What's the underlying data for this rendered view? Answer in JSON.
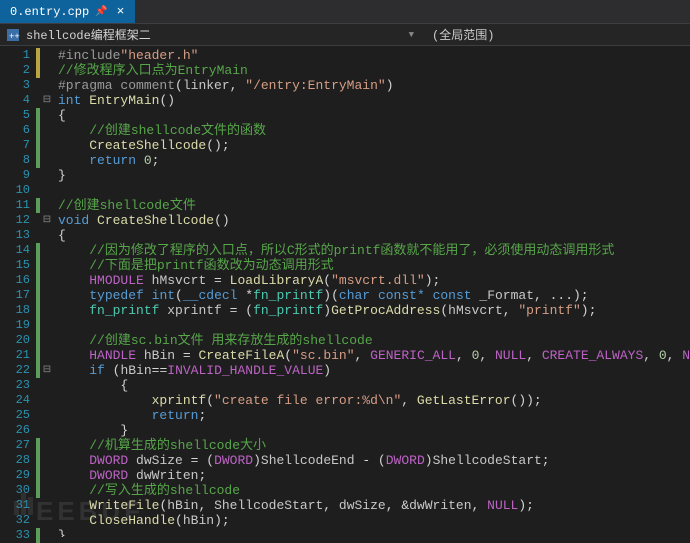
{
  "tab": {
    "filename": "0.entry.cpp",
    "pin": "📌",
    "close": "×"
  },
  "nav": {
    "unit": "shellcode编程框架二",
    "scope": "(全局范围)"
  },
  "watermark": "EEBUF",
  "lines": [
    {
      "n": 1,
      "fold": "",
      "chg": "y",
      "tokens": [
        [
          "pp",
          "#include"
        ],
        [
          "str",
          "\"header.h\""
        ]
      ]
    },
    {
      "n": 2,
      "fold": "",
      "chg": "y",
      "tokens": [
        [
          "cmt",
          "//修改程序入口点为EntryMain"
        ]
      ]
    },
    {
      "n": 3,
      "fold": "",
      "chg": "",
      "tokens": [
        [
          "pp",
          "#pragma comment"
        ],
        [
          "pun",
          "("
        ],
        [
          "id",
          "linker"
        ],
        [
          "pun",
          ", "
        ],
        [
          "str",
          "\"/entry:EntryMain\""
        ],
        [
          "pun",
          ")"
        ]
      ]
    },
    {
      "n": 4,
      "fold": "⊟",
      "chg": "",
      "tokens": [
        [
          "kw",
          "int"
        ],
        [
          "pun",
          " "
        ],
        [
          "fn",
          "EntryMain"
        ],
        [
          "pun",
          "()"
        ]
      ]
    },
    {
      "n": 5,
      "fold": "",
      "chg": "g",
      "tokens": [
        [
          "pun",
          "{"
        ]
      ]
    },
    {
      "n": 6,
      "fold": "",
      "chg": "g",
      "tokens": [
        [
          "pun",
          "    "
        ],
        [
          "cmt",
          "//创建shellcode文件的函数"
        ]
      ]
    },
    {
      "n": 7,
      "fold": "",
      "chg": "g",
      "tokens": [
        [
          "pun",
          "    "
        ],
        [
          "fn",
          "CreateShellcode"
        ],
        [
          "pun",
          "();"
        ]
      ]
    },
    {
      "n": 8,
      "fold": "",
      "chg": "g",
      "tokens": [
        [
          "pun",
          "    "
        ],
        [
          "kw",
          "return"
        ],
        [
          "pun",
          " "
        ],
        [
          "num",
          "0"
        ],
        [
          "pun",
          ";"
        ]
      ]
    },
    {
      "n": 9,
      "fold": "",
      "chg": "",
      "tokens": [
        [
          "pun",
          "}"
        ]
      ]
    },
    {
      "n": 10,
      "fold": "",
      "chg": "",
      "tokens": []
    },
    {
      "n": 11,
      "fold": "",
      "chg": "g",
      "tokens": [
        [
          "cmt",
          "//创建shellcode文件"
        ]
      ]
    },
    {
      "n": 12,
      "fold": "⊟",
      "chg": "",
      "tokens": [
        [
          "kw",
          "void"
        ],
        [
          "pun",
          " "
        ],
        [
          "fn",
          "CreateShellcode"
        ],
        [
          "pun",
          "()"
        ]
      ]
    },
    {
      "n": 13,
      "fold": "",
      "chg": "",
      "tokens": [
        [
          "pun",
          "{"
        ]
      ]
    },
    {
      "n": 14,
      "fold": "",
      "chg": "g",
      "tokens": [
        [
          "pun",
          "    "
        ],
        [
          "cmt",
          "//因为修改了程序的入口点，所以C形式的printf函数就不能用了，必须使用动态调用形式"
        ]
      ]
    },
    {
      "n": 15,
      "fold": "",
      "chg": "g",
      "tokens": [
        [
          "pun",
          "    "
        ],
        [
          "cmt",
          "//下面是把printf函数改为动态调用形式"
        ]
      ]
    },
    {
      "n": 16,
      "fold": "",
      "chg": "g",
      "tokens": [
        [
          "pun",
          "    "
        ],
        [
          "mac",
          "HMODULE"
        ],
        [
          "pun",
          " "
        ],
        [
          "id",
          "hMsvcrt"
        ],
        [
          "pun",
          " = "
        ],
        [
          "fn",
          "LoadLibraryA"
        ],
        [
          "pun",
          "("
        ],
        [
          "str",
          "\"msvcrt.dll\""
        ],
        [
          "pun",
          ");"
        ]
      ]
    },
    {
      "n": 17,
      "fold": "",
      "chg": "g",
      "tokens": [
        [
          "pun",
          "    "
        ],
        [
          "kw",
          "typedef"
        ],
        [
          "pun",
          " "
        ],
        [
          "kw",
          "int"
        ],
        [
          "pun",
          "("
        ],
        [
          "kw",
          "__cdecl"
        ],
        [
          "pun",
          " *"
        ],
        [
          "gtype",
          "fn_printf"
        ],
        [
          "pun",
          ")("
        ],
        [
          "kw",
          "char"
        ],
        [
          "pun",
          " "
        ],
        [
          "kw",
          "const*"
        ],
        [
          "pun",
          " "
        ],
        [
          "kw",
          "const"
        ],
        [
          "pun",
          " "
        ],
        [
          "id",
          "_Format"
        ],
        [
          "pun",
          ", ...);"
        ]
      ]
    },
    {
      "n": 18,
      "fold": "",
      "chg": "g",
      "tokens": [
        [
          "pun",
          "    "
        ],
        [
          "gtype",
          "fn_printf"
        ],
        [
          "pun",
          " "
        ],
        [
          "id",
          "xprintf"
        ],
        [
          "pun",
          " = ("
        ],
        [
          "gtype",
          "fn_printf"
        ],
        [
          "pun",
          ")"
        ],
        [
          "fn",
          "GetProcAddress"
        ],
        [
          "pun",
          "("
        ],
        [
          "id",
          "hMsvcrt"
        ],
        [
          "pun",
          ", "
        ],
        [
          "str",
          "\"printf\""
        ],
        [
          "pun",
          ");"
        ]
      ]
    },
    {
      "n": 19,
      "fold": "",
      "chg": "g",
      "tokens": []
    },
    {
      "n": 20,
      "fold": "",
      "chg": "g",
      "tokens": [
        [
          "pun",
          "    "
        ],
        [
          "cmt",
          "//创建sc.bin文件 用来存放生成的shellcode"
        ]
      ]
    },
    {
      "n": 21,
      "fold": "",
      "chg": "g",
      "tokens": [
        [
          "pun",
          "    "
        ],
        [
          "mac",
          "HANDLE"
        ],
        [
          "pun",
          " "
        ],
        [
          "id",
          "hBin"
        ],
        [
          "pun",
          " = "
        ],
        [
          "fn",
          "CreateFileA"
        ],
        [
          "pun",
          "("
        ],
        [
          "str",
          "\"sc.bin\""
        ],
        [
          "pun",
          ", "
        ],
        [
          "mac",
          "GENERIC_ALL"
        ],
        [
          "pun",
          ", "
        ],
        [
          "num",
          "0"
        ],
        [
          "pun",
          ", "
        ],
        [
          "mac",
          "NULL"
        ],
        [
          "pun",
          ", "
        ],
        [
          "mac",
          "CREATE_ALWAYS"
        ],
        [
          "pun",
          ", "
        ],
        [
          "num",
          "0"
        ],
        [
          "pun",
          ", "
        ],
        [
          "mac",
          "NULL"
        ],
        [
          "pun",
          ");"
        ]
      ]
    },
    {
      "n": 22,
      "fold": "⊟",
      "chg": "g",
      "tokens": [
        [
          "pun",
          "    "
        ],
        [
          "kw",
          "if"
        ],
        [
          "pun",
          " ("
        ],
        [
          "id",
          "hBin"
        ],
        [
          "pun",
          "=="
        ],
        [
          "mac",
          "INVALID_HANDLE_VALUE"
        ],
        [
          "pun",
          ")"
        ]
      ]
    },
    {
      "n": 23,
      "fold": "",
      "chg": "",
      "tokens": [
        [
          "pun",
          "        {"
        ]
      ]
    },
    {
      "n": 24,
      "fold": "",
      "chg": "",
      "tokens": [
        [
          "pun",
          "            "
        ],
        [
          "fn",
          "xprintf"
        ],
        [
          "pun",
          "("
        ],
        [
          "str",
          "\"create file error:%d\\n\""
        ],
        [
          "pun",
          ", "
        ],
        [
          "fn",
          "GetLastError"
        ],
        [
          "pun",
          "());"
        ]
      ]
    },
    {
      "n": 25,
      "fold": "",
      "chg": "",
      "tokens": [
        [
          "pun",
          "            "
        ],
        [
          "kw",
          "return"
        ],
        [
          "pun",
          ";"
        ]
      ]
    },
    {
      "n": 26,
      "fold": "",
      "chg": "",
      "tokens": [
        [
          "pun",
          "        }"
        ]
      ]
    },
    {
      "n": 27,
      "fold": "",
      "chg": "g",
      "tokens": [
        [
          "pun",
          "    "
        ],
        [
          "cmt",
          "//机算生成的shellcode大小"
        ]
      ]
    },
    {
      "n": 28,
      "fold": "",
      "chg": "g",
      "tokens": [
        [
          "pun",
          "    "
        ],
        [
          "mac",
          "DWORD"
        ],
        [
          "pun",
          " "
        ],
        [
          "id",
          "dwSize"
        ],
        [
          "pun",
          " = ("
        ],
        [
          "mac",
          "DWORD"
        ],
        [
          "pun",
          ")"
        ],
        [
          "id",
          "ShellcodeEnd"
        ],
        [
          "pun",
          " - ("
        ],
        [
          "mac",
          "DWORD"
        ],
        [
          "pun",
          ")"
        ],
        [
          "id",
          "ShellcodeStart"
        ],
        [
          "pun",
          ";"
        ]
      ]
    },
    {
      "n": 29,
      "fold": "",
      "chg": "g",
      "tokens": [
        [
          "pun",
          "    "
        ],
        [
          "mac",
          "DWORD"
        ],
        [
          "pun",
          " "
        ],
        [
          "id",
          "dwWriten"
        ],
        [
          "pun",
          ";"
        ]
      ]
    },
    {
      "n": 30,
      "fold": "",
      "chg": "g",
      "tokens": [
        [
          "pun",
          "    "
        ],
        [
          "cmt",
          "//写入生成的shellcode"
        ]
      ]
    },
    {
      "n": 31,
      "fold": "",
      "chg": "",
      "tokens": [
        [
          "pun",
          "    "
        ],
        [
          "fn",
          "WriteFile"
        ],
        [
          "pun",
          "("
        ],
        [
          "id",
          "hBin"
        ],
        [
          "pun",
          ", "
        ],
        [
          "id",
          "ShellcodeStart"
        ],
        [
          "pun",
          ", "
        ],
        [
          "id",
          "dwSize"
        ],
        [
          "pun",
          ", &"
        ],
        [
          "id",
          "dwWriten"
        ],
        [
          "pun",
          ", "
        ],
        [
          "mac",
          "NULL"
        ],
        [
          "pun",
          ");"
        ]
      ]
    },
    {
      "n": 32,
      "fold": "",
      "chg": "",
      "tokens": [
        [
          "pun",
          "    "
        ],
        [
          "fn",
          "CloseHandle"
        ],
        [
          "pun",
          "("
        ],
        [
          "id",
          "hBin"
        ],
        [
          "pun",
          ");"
        ]
      ]
    },
    {
      "n": 33,
      "fold": "",
      "chg": "g",
      "tokens": [
        [
          "pun",
          "}"
        ]
      ]
    }
  ]
}
